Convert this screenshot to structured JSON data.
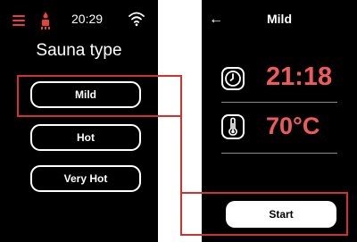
{
  "left_screen": {
    "status": {
      "time": "20:29"
    },
    "title": "Sauna type",
    "options": [
      {
        "label": "Mild"
      },
      {
        "label": "Hot"
      },
      {
        "label": "Very Hot"
      }
    ]
  },
  "right_screen": {
    "title": "Mild",
    "time_value": "21:18",
    "temperature_value": "70°C",
    "start_label": "Start"
  },
  "colors": {
    "accent": "#ef5b5b",
    "annotation": "#d1312f",
    "background": "#000000",
    "text": "#ffffff"
  }
}
